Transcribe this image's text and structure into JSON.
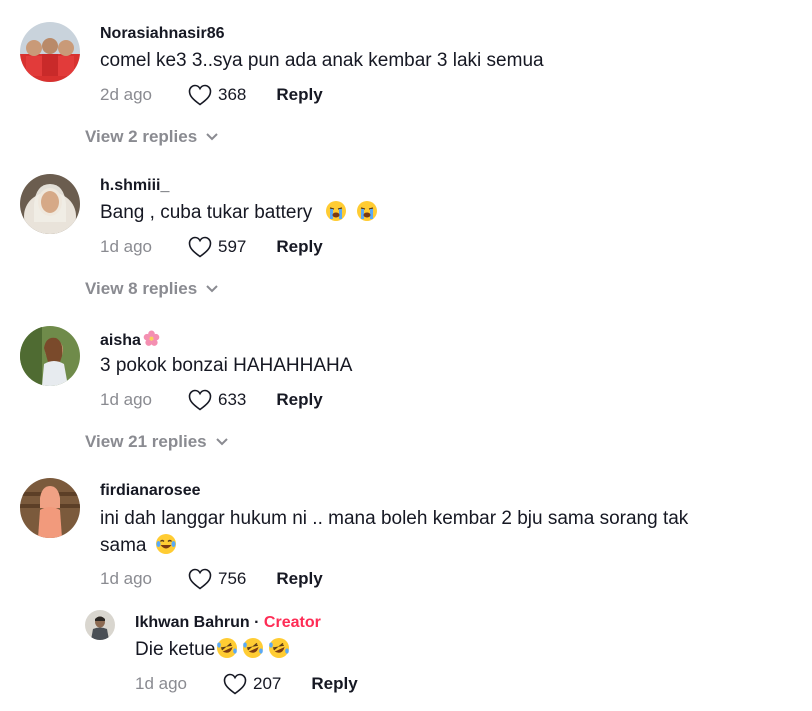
{
  "comments": [
    {
      "username": "Norasiahnasir86",
      "text": "comel ke3 3..sya pun ada anak kembar 3 laki semua",
      "date": "2d ago",
      "likes": "368",
      "reply_label": "Reply",
      "view_replies": "View 2 replies"
    },
    {
      "username": "h.shmiii_",
      "text": "Bang , cuba tukar battery",
      "emoji": "😭😭",
      "date": "1d ago",
      "likes": "597",
      "reply_label": "Reply",
      "view_replies": "View 8 replies"
    },
    {
      "username": "aisha",
      "username_emoji": "🌸",
      "text": "3 pokok bonzai HAHAHHAHA",
      "date": "1d ago",
      "likes": "633",
      "reply_label": "Reply",
      "view_replies": "View 21 replies"
    },
    {
      "username": "firdianarosee",
      "text_line1": "ini dah langgar hukum ni .. mana boleh kembar 2 bju sama sorang tak",
      "text_line2": "sama",
      "emoji": "😂",
      "date": "1d ago",
      "likes": "756",
      "reply_label": "Reply"
    }
  ],
  "reply": {
    "username": "Ikhwan Bahrun",
    "separator": "·",
    "creator_label": "Creator",
    "text": "Die ketue",
    "emoji": "🤣🤣🤣",
    "date": "1d ago",
    "likes": "207",
    "reply_label": "Reply"
  },
  "colors": {
    "text": "#161823",
    "muted": "#8a8b91",
    "creator": "#fe2c55"
  },
  "icons": {
    "like": "heart-outline-icon",
    "expand": "chevron-down-icon"
  }
}
